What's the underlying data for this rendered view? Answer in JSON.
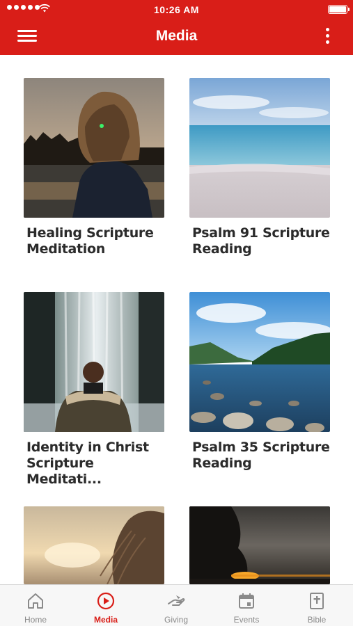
{
  "status_bar": {
    "time": "10:26 AM"
  },
  "header": {
    "title": "Media"
  },
  "media_items": [
    {
      "title_line1": "Healing Scripture",
      "title_line2": "Meditation"
    },
    {
      "title_line1": "Psalm 91 Scripture",
      "title_line2": "Reading"
    },
    {
      "title_line1": "Identity in Christ",
      "title_line2": "Scripture Meditati..."
    },
    {
      "title_line1": "Psalm 35 Scripture",
      "title_line2": "Reading"
    }
  ],
  "tabs": [
    {
      "label": "Home",
      "icon": "home-icon"
    },
    {
      "label": "Media",
      "icon": "play-circle-icon",
      "active": true
    },
    {
      "label": "Giving",
      "icon": "giving-hand-icon"
    },
    {
      "label": "Events",
      "icon": "calendar-icon"
    },
    {
      "label": "Bible",
      "icon": "bible-icon"
    }
  ],
  "colors": {
    "brand": "#d91e18",
    "tab_inactive": "#8a8a8a",
    "title_text": "#2b2b2b"
  }
}
